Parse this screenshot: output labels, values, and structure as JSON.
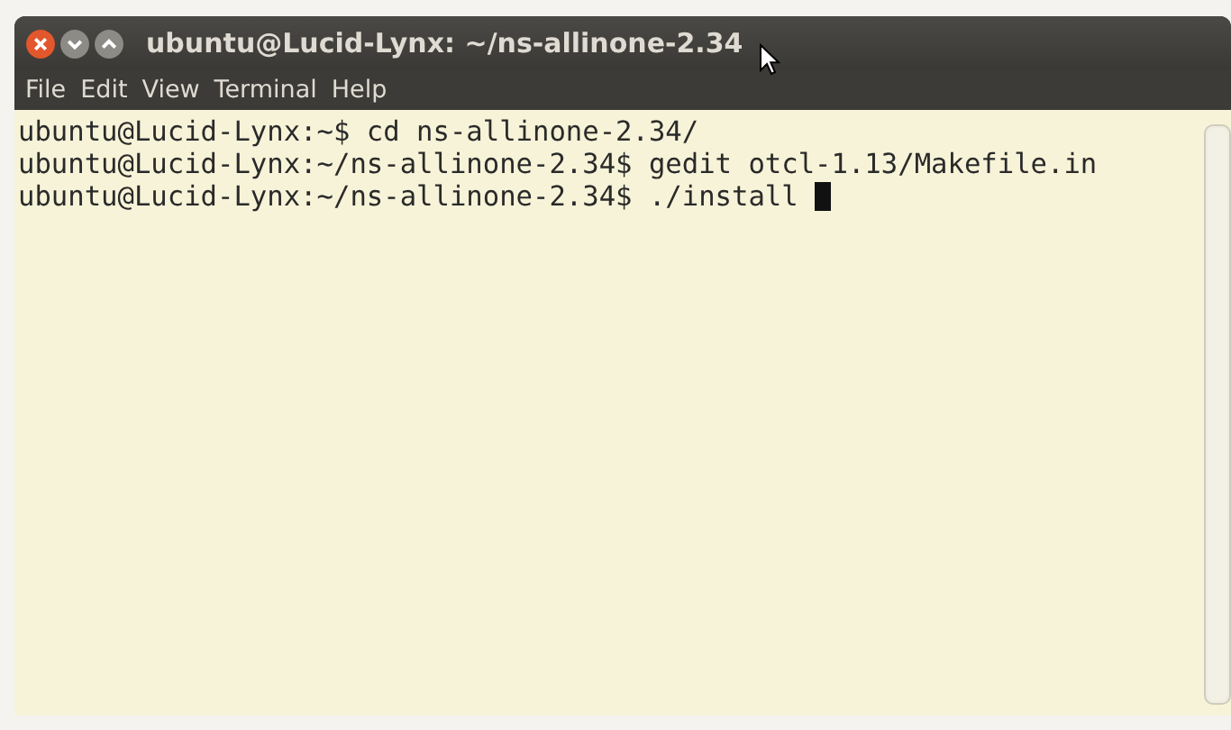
{
  "window": {
    "title": "ubuntu@Lucid-Lynx: ~/ns-allinone-2.34"
  },
  "menu": [
    "File",
    "Edit",
    "View",
    "Terminal",
    "Help"
  ],
  "terminal": {
    "lines": [
      "ubuntu@Lucid-Lynx:~$ cd ns-allinone-2.34/",
      "ubuntu@Lucid-Lynx:~/ns-allinone-2.34$ gedit otcl-1.13/Makefile.in",
      "ubuntu@Lucid-Lynx:~/ns-allinone-2.34$ ./install "
    ]
  }
}
